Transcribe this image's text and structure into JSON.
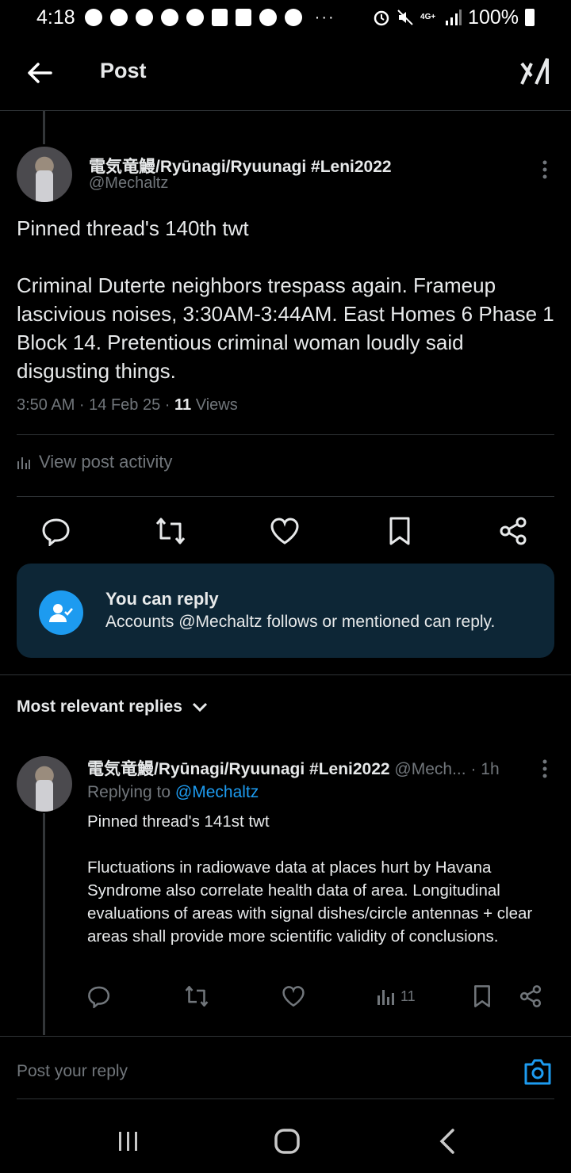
{
  "status_bar": {
    "time": "4:18",
    "battery": "100%",
    "overflow": "···",
    "network": "4G+"
  },
  "header": {
    "title": "Post"
  },
  "post": {
    "display_name": "電気竜鰻/Ryūnagi/Ryuunagi #Leni2022",
    "handle": "@Mechaltz",
    "text_line1": "Pinned thread's 140th twt",
    "text_body": "Criminal Duterte neighbors trespass again. Frameup lascivious noises, 3:30AM-3:44AM. East Homes 6 Phase 1 Block 14. Pretentious criminal woman loudly said disgusting things.",
    "time": "3:50 AM · 14 Feb 25 · ",
    "views_count": "11",
    "views_label": " Views",
    "activity": "View post activity"
  },
  "reply_box": {
    "title": "You can reply",
    "subtitle": "Accounts @Mechaltz follows or mentioned can reply."
  },
  "sort": {
    "label": "Most relevant replies"
  },
  "reply": {
    "display_name": "電気竜鰻/Ryūnagi/Ryuunagi #Leni2022",
    "handle": " @Mech...",
    "time": " · 1h",
    "replying_prefix": "Replying to ",
    "replying_to": "@Mechaltz",
    "text_line1": "Pinned thread's 141st twt",
    "text_body": "Fluctuations in radiowave data at places hurt by Havana Syndrome also correlate health data of area. Longitudinal evaluations of areas with signal dishes/circle antennas + clear areas shall provide more scientific validity of conclusions.",
    "views": "11"
  },
  "compose": {
    "placeholder": "Post your reply"
  },
  "colors": {
    "accent": "#1d9bf0",
    "muted": "#71767b",
    "text": "#e7e9ea",
    "background": "#000000",
    "reply_box_bg": "#0d2636"
  }
}
